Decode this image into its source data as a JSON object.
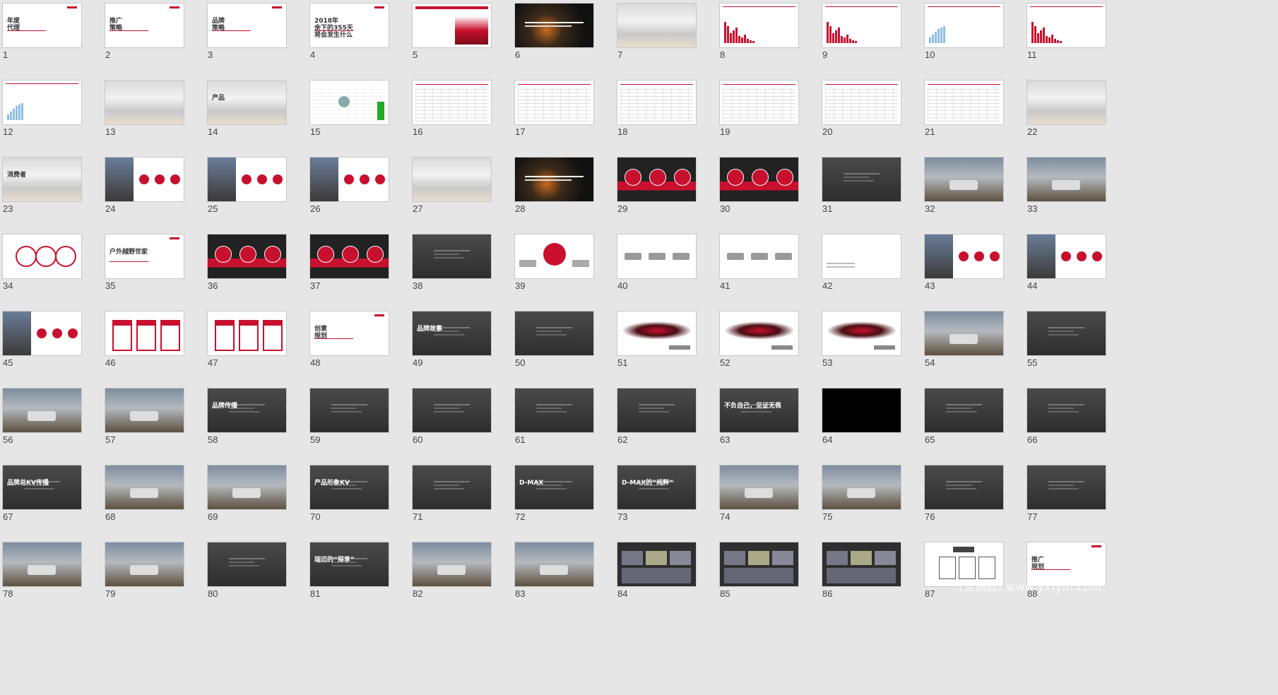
{
  "watermark": "(营销圈) www.yxlym.com",
  "colors": {
    "brand_red": "#c8102e",
    "dark": "#3a3a3a",
    "background": "#e6e6e6"
  },
  "slides": [
    {
      "n": "1",
      "style": "light",
      "text": "年度\n代理"
    },
    {
      "n": "2",
      "style": "light",
      "text": "推广\n策略"
    },
    {
      "n": "3",
      "style": "light",
      "text": "品牌\n策略"
    },
    {
      "n": "4",
      "style": "light",
      "text": "2018年\n余下的355天\n将会发生什么"
    },
    {
      "n": "5",
      "style": "redchart",
      "text": ""
    },
    {
      "n": "6",
      "style": "nightcity",
      "text": ""
    },
    {
      "n": "7",
      "style": "sky",
      "text": ""
    },
    {
      "n": "8",
      "style": "chart",
      "text": ""
    },
    {
      "n": "9",
      "style": "chart",
      "text": ""
    },
    {
      "n": "10",
      "style": "chartlight",
      "text": ""
    },
    {
      "n": "11",
      "style": "chart",
      "text": ""
    },
    {
      "n": "12",
      "style": "chartlight",
      "text": ""
    },
    {
      "n": "13",
      "style": "sky",
      "text": ""
    },
    {
      "n": "14",
      "style": "sky",
      "text": "产品"
    },
    {
      "n": "15",
      "style": "map",
      "text": ""
    },
    {
      "n": "16",
      "style": "table",
      "text": ""
    },
    {
      "n": "17",
      "style": "table",
      "text": ""
    },
    {
      "n": "18",
      "style": "table",
      "text": ""
    },
    {
      "n": "19",
      "style": "table",
      "text": ""
    },
    {
      "n": "20",
      "style": "table",
      "text": ""
    },
    {
      "n": "21",
      "style": "table",
      "text": ""
    },
    {
      "n": "22",
      "style": "sky",
      "text": ""
    },
    {
      "n": "23",
      "style": "sky",
      "text": "消费者"
    },
    {
      "n": "24",
      "style": "photo",
      "text": ""
    },
    {
      "n": "25",
      "style": "photo",
      "text": ""
    },
    {
      "n": "26",
      "style": "photo",
      "text": ""
    },
    {
      "n": "27",
      "style": "sky",
      "text": ""
    },
    {
      "n": "28",
      "style": "nightcity",
      "text": ""
    },
    {
      "n": "29",
      "style": "darkred",
      "text": ""
    },
    {
      "n": "30",
      "style": "darkred",
      "text": ""
    },
    {
      "n": "31",
      "style": "dark",
      "text": ""
    },
    {
      "n": "32",
      "style": "car",
      "text": ""
    },
    {
      "n": "33",
      "style": "car",
      "text": ""
    },
    {
      "n": "34",
      "style": "circles",
      "text": ""
    },
    {
      "n": "35",
      "style": "light",
      "text": "户外越野世家"
    },
    {
      "n": "36",
      "style": "darkred",
      "text": ""
    },
    {
      "n": "37",
      "style": "darkred",
      "text": ""
    },
    {
      "n": "38",
      "style": "dark",
      "text": ""
    },
    {
      "n": "39",
      "style": "redcirc",
      "text": ""
    },
    {
      "n": "40",
      "style": "cars",
      "text": ""
    },
    {
      "n": "41",
      "style": "cars",
      "text": ""
    },
    {
      "n": "42",
      "style": "blank",
      "text": ""
    },
    {
      "n": "43",
      "style": "photo",
      "text": ""
    },
    {
      "n": "44",
      "style": "photo",
      "text": ""
    },
    {
      "n": "45",
      "style": "photo",
      "text": ""
    },
    {
      "n": "46",
      "style": "redboxes",
      "text": ""
    },
    {
      "n": "47",
      "style": "redboxes",
      "text": ""
    },
    {
      "n": "48",
      "style": "light",
      "text": "创意\n规划"
    },
    {
      "n": "49",
      "style": "dark",
      "text": "品牌故事"
    },
    {
      "n": "50",
      "style": "dark",
      "text": ""
    },
    {
      "n": "51",
      "style": "ink",
      "text": ""
    },
    {
      "n": "52",
      "style": "ink",
      "text": ""
    },
    {
      "n": "53",
      "style": "ink",
      "text": ""
    },
    {
      "n": "54",
      "style": "poster",
      "text": ""
    },
    {
      "n": "55",
      "style": "dark",
      "text": ""
    },
    {
      "n": "56",
      "style": "poster",
      "text": ""
    },
    {
      "n": "57",
      "style": "poster",
      "text": ""
    },
    {
      "n": "58",
      "style": "dark",
      "text": "品牌传播"
    },
    {
      "n": "59",
      "style": "dark",
      "text": ""
    },
    {
      "n": "60",
      "style": "dark",
      "text": ""
    },
    {
      "n": "61",
      "style": "dark",
      "text": ""
    },
    {
      "n": "62",
      "style": "dark",
      "text": ""
    },
    {
      "n": "63",
      "style": "dark",
      "text": "不负自己，见证无畏"
    },
    {
      "n": "64",
      "style": "black",
      "text": ""
    },
    {
      "n": "65",
      "style": "dark",
      "text": ""
    },
    {
      "n": "66",
      "style": "dark",
      "text": ""
    },
    {
      "n": "67",
      "style": "dark",
      "text": "品牌总KV传播"
    },
    {
      "n": "68",
      "style": "poster",
      "text": ""
    },
    {
      "n": "69",
      "style": "poster",
      "text": ""
    },
    {
      "n": "70",
      "style": "dark",
      "text": "产品形象KV"
    },
    {
      "n": "71",
      "style": "dark",
      "text": ""
    },
    {
      "n": "72",
      "style": "dark",
      "text": "D-MAX"
    },
    {
      "n": "73",
      "style": "dark",
      "text": "D-MAX的“纯粹”"
    },
    {
      "n": "74",
      "style": "poster",
      "text": ""
    },
    {
      "n": "75",
      "style": "poster",
      "text": ""
    },
    {
      "n": "76",
      "style": "dark",
      "text": ""
    },
    {
      "n": "77",
      "style": "dark",
      "text": ""
    },
    {
      "n": "78",
      "style": "poster",
      "text": ""
    },
    {
      "n": "79",
      "style": "poster",
      "text": ""
    },
    {
      "n": "80",
      "style": "dark",
      "text": ""
    },
    {
      "n": "81",
      "style": "dark",
      "text": "瑞迈的“探享”"
    },
    {
      "n": "82",
      "style": "poster",
      "text": ""
    },
    {
      "n": "83",
      "style": "poster",
      "text": ""
    },
    {
      "n": "84",
      "style": "collage",
      "text": ""
    },
    {
      "n": "85",
      "style": "collage",
      "text": ""
    },
    {
      "n": "86",
      "style": "collage",
      "text": ""
    },
    {
      "n": "87",
      "style": "org",
      "text": ""
    },
    {
      "n": "88",
      "style": "light",
      "text": "推广\n规划"
    }
  ]
}
